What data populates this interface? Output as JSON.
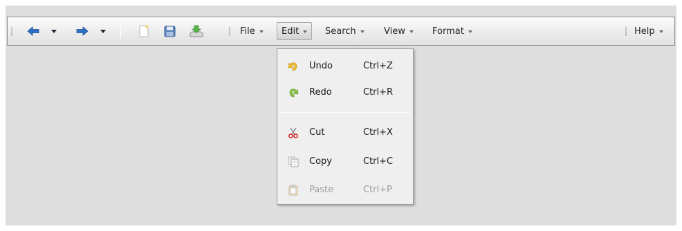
{
  "toolbar": {
    "nav": [
      {
        "name": "back-arrow-icon"
      },
      {
        "name": "forward-arrow-icon"
      }
    ],
    "icons": [
      "new-document-icon",
      "save-disk-icon",
      "download-icon"
    ],
    "menus": [
      {
        "id": "file",
        "label": "File"
      },
      {
        "id": "edit",
        "label": "Edit",
        "active": true
      },
      {
        "id": "search",
        "label": "Search"
      },
      {
        "id": "view",
        "label": "View"
      },
      {
        "id": "format",
        "label": "Format"
      }
    ],
    "help": {
      "label": "Help"
    }
  },
  "edit_menu": {
    "items": [
      {
        "icon": "undo-icon",
        "label": "Undo",
        "shortcut": "Ctrl+Z",
        "enabled": true
      },
      {
        "icon": "redo-icon",
        "label": "Redo",
        "shortcut": "Ctrl+R",
        "enabled": true
      },
      {
        "icon": "scissors-icon",
        "label": "Cut",
        "shortcut": "Ctrl+X",
        "enabled": true
      },
      {
        "icon": "copy-icon",
        "label": "Copy",
        "shortcut": "Ctrl+C",
        "enabled": true
      },
      {
        "icon": "paste-icon",
        "label": "Paste",
        "shortcut": "Ctrl+P",
        "enabled": false
      }
    ]
  },
  "colors": {
    "panel": "#dedede",
    "arrow": "#2c6fc4",
    "disabled_text": "#9c9c9c"
  }
}
